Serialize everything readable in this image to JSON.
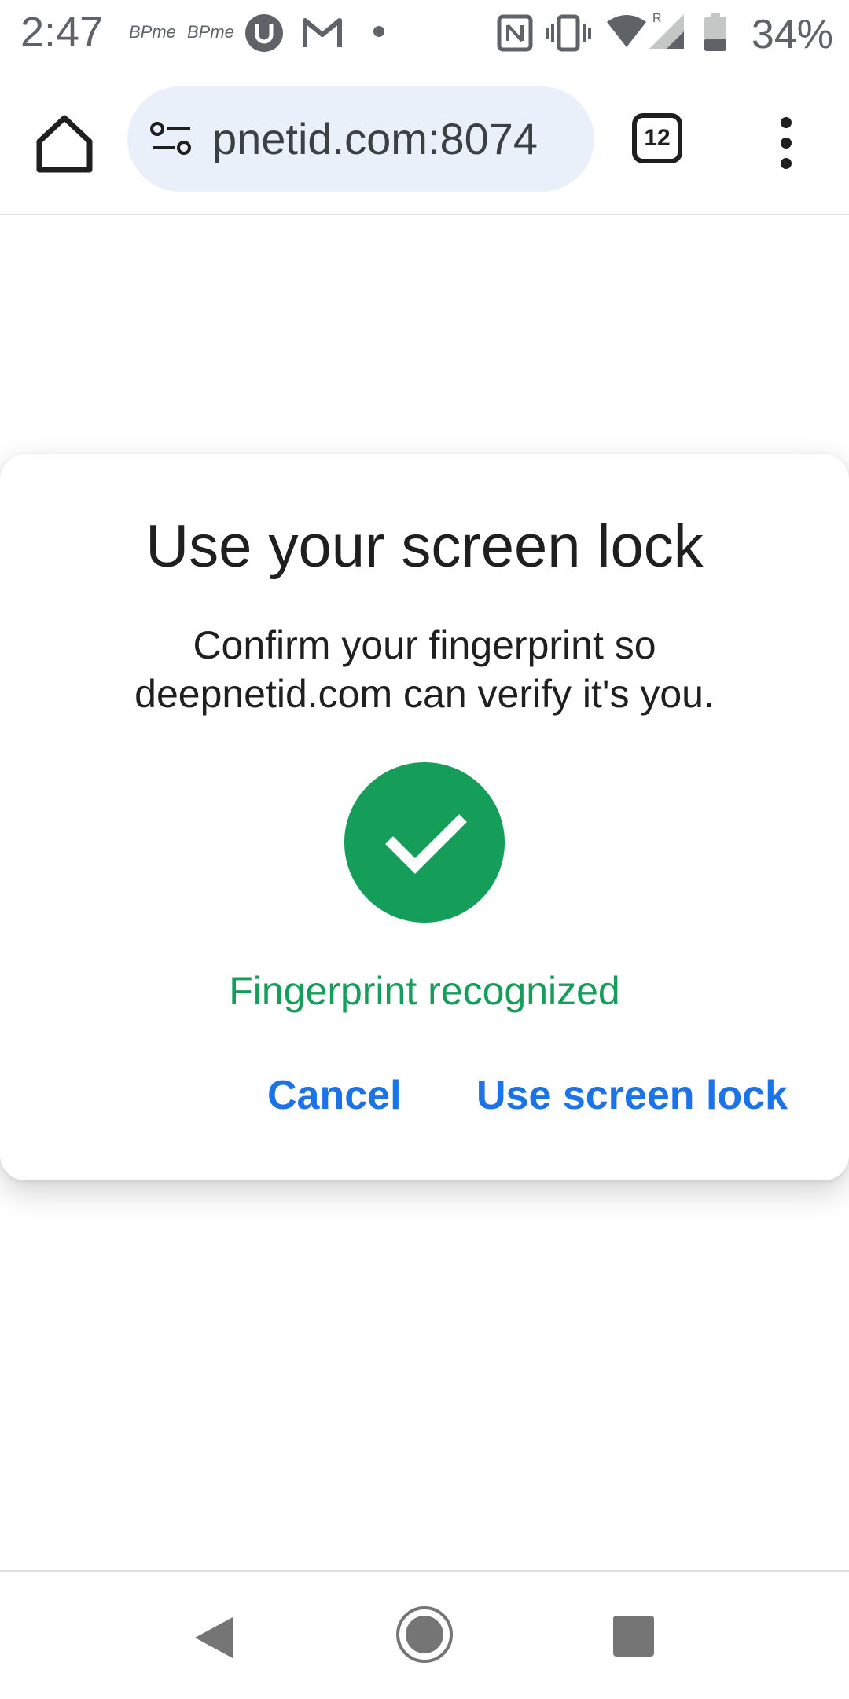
{
  "status_bar": {
    "time": "2:47",
    "notif_1": "BPme",
    "notif_2": "BPme",
    "battery_percent": "34%",
    "icons": [
      "bpme-icon",
      "bpme-icon",
      "u-icon",
      "gmail-icon",
      "dot-icon",
      "nfc-icon",
      "vibrate-icon",
      "wifi-icon",
      "signal-icon",
      "battery-icon"
    ]
  },
  "browser": {
    "url_text": "pnetid.com:8074",
    "tab_count": "12"
  },
  "dialog": {
    "title": "Use your screen lock",
    "message": "Confirm your fingerprint so deepnetid.com can verify it's you.",
    "status": "Fingerprint recognized",
    "cancel_label": "Cancel",
    "confirm_label": "Use screen lock"
  },
  "colors": {
    "success": "#149e5a",
    "accent": "#1a73e8",
    "omnibox_bg": "#eaf0f9"
  }
}
